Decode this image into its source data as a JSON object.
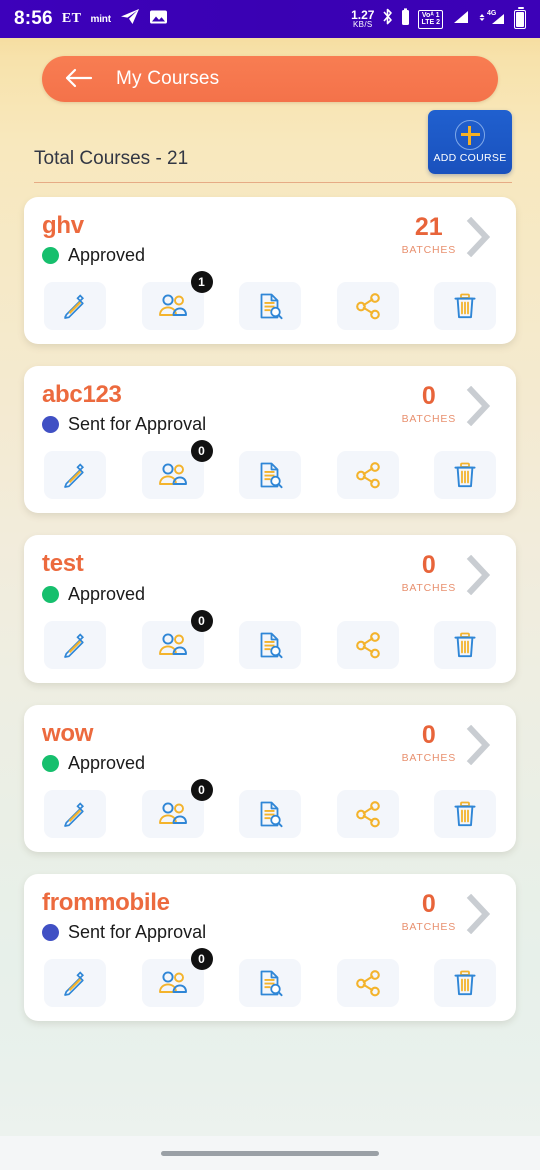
{
  "status_bar": {
    "time": "8:56",
    "carrier_label": "ET",
    "app_label": "mint",
    "icons": [
      "telegram-icon",
      "photos-icon"
    ],
    "net_speed_value": "1.27",
    "net_speed_unit": "KB/S",
    "bluetooth": "bluetooth-icon",
    "volte_line1": "Voᴬ 1",
    "volte_line2": "LTE 2",
    "network_type": "4G",
    "battery": "battery-full-icon",
    "background_color": "#3a00b5"
  },
  "appbar": {
    "title": "My Courses",
    "back_icon": "back-arrow-icon",
    "color": "#f4764b"
  },
  "header": {
    "total_text": "Total Courses - 21",
    "add_course_label": "ADD COURSE",
    "add_course_icon": "plus-icon",
    "add_course_color": "#1b55c4"
  },
  "labels": {
    "batches": "BATCHES"
  },
  "status_colors": {
    "approved": "#16bf6d",
    "sent_for_approval": "#4050c4"
  },
  "action_icons": [
    {
      "name": "edit-pencil-icon",
      "label": "Edit"
    },
    {
      "name": "students-people-icon",
      "label": "Students"
    },
    {
      "name": "document-search-icon",
      "label": "Reports"
    },
    {
      "name": "share-icon",
      "label": "Share"
    },
    {
      "name": "delete-trash-icon",
      "label": "Delete"
    }
  ],
  "courses": [
    {
      "name": "ghv",
      "status": "Approved",
      "status_type": "approved",
      "batch_count": "21",
      "student_badge": "1"
    },
    {
      "name": "abc123",
      "status": "Sent for Approval",
      "status_type": "sent_for_approval",
      "batch_count": "0",
      "student_badge": "0"
    },
    {
      "name": "test",
      "status": "Approved",
      "status_type": "approved",
      "batch_count": "0",
      "student_badge": "0"
    },
    {
      "name": "wow",
      "status": "Approved",
      "status_type": "approved",
      "batch_count": "0",
      "student_badge": "0"
    },
    {
      "name": "frommobile",
      "status": "Sent for Approval",
      "status_type": "sent_for_approval",
      "batch_count": "0",
      "student_badge": "0"
    }
  ]
}
